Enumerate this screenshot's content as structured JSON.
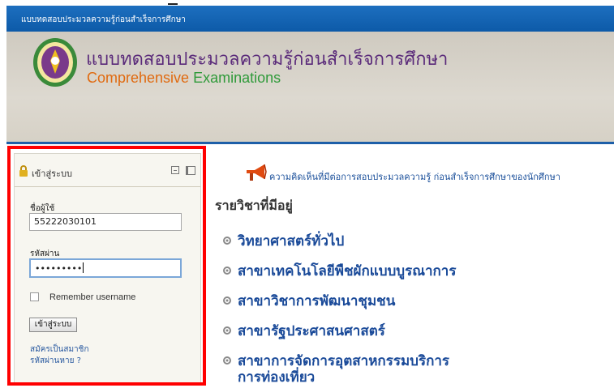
{
  "topbar": {
    "title": "แบบทดสอบประมวลความรู้ก่อนสำเร็จการศึกษา"
  },
  "header": {
    "title_th": "แบบทดสอบประมวลความรู้ก่อนสำเร็จการศึกษา",
    "title_en_part1": "Comprehensive",
    "title_en_part2": "Examinations"
  },
  "login": {
    "title": "เข้าสู่ระบบ",
    "username_label": "ชื่อผู้ใช้",
    "username_value": "55222030101",
    "password_label": "รหัสผ่าน",
    "password_value": "•••••••••",
    "remember_label": "Remember username",
    "submit_label": "เข้าสู่ระบบ",
    "signup_link": "สมัครเป็นสมาชิก",
    "forgot_link": "รหัสผ่านหาย ?"
  },
  "main": {
    "comment_text": "ความคิดเห็นที่มีต่อการสอบประมวลความรู้ ก่อนสำเร็จการศึกษาของนักศึกษา",
    "available_heading": "รายวิชาที่มีอยู่",
    "courses": [
      {
        "label": "วิทยาศาสตร์ทั่วไป"
      },
      {
        "label": "สาขาเทคโนโลยีพืชผักแบบบูรณาการ"
      },
      {
        "label": "สาขาวิชาการพัฒนาชุมชน"
      },
      {
        "label": "สาขารัฐประศาสนศาสตร์"
      },
      {
        "label": "สาขาการจัดการอุตสาหกรรมบริการ",
        "label2": "การท่องเที่ยว"
      }
    ]
  },
  "colors": {
    "topbar": "#1d6fbf",
    "highlight": "#ff0000",
    "link": "#1a4a99"
  }
}
